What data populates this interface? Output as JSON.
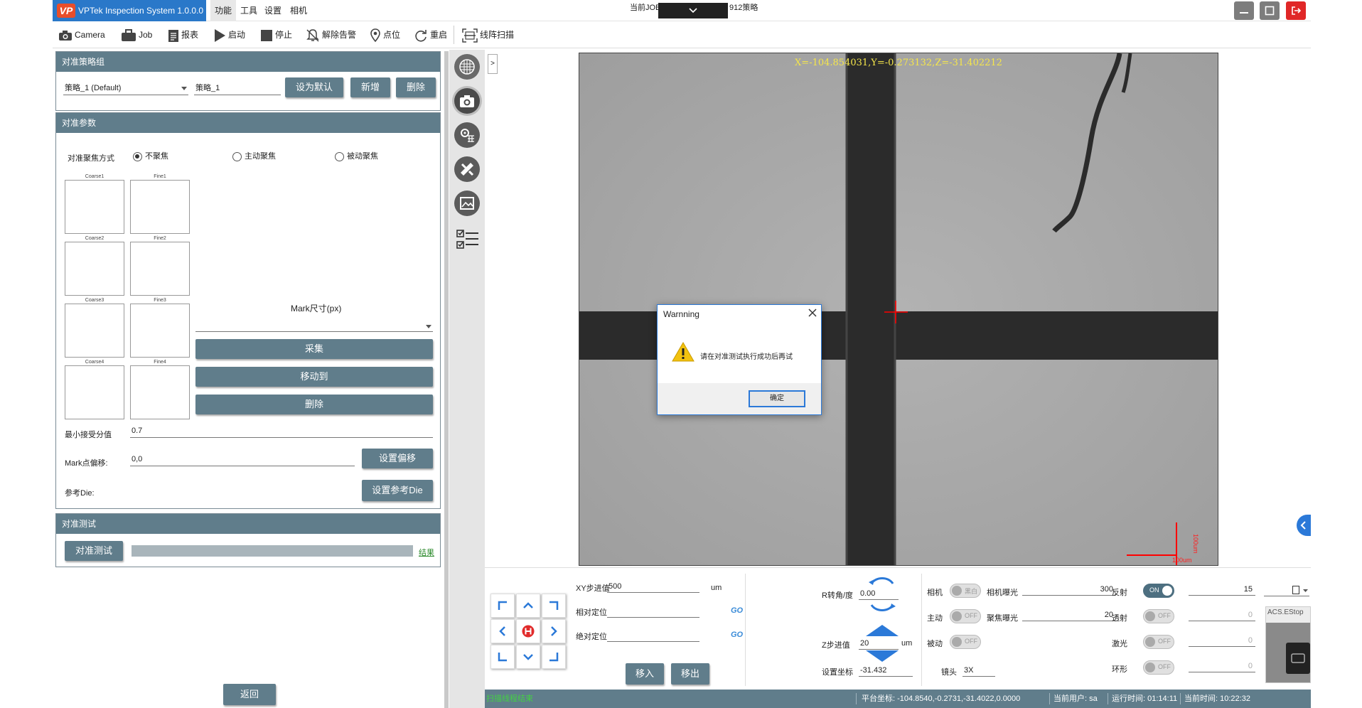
{
  "app": {
    "title": "VPTek Inspection System 1.0.0.0",
    "logo": "VP"
  },
  "menu": [
    "功能",
    "工具",
    "设置",
    "相机"
  ],
  "job": {
    "label_left": "当前JOB",
    "label_right": "912策略"
  },
  "toolbar": [
    "Camera",
    "Job",
    "报表",
    "启动",
    "停止",
    "解除告警",
    "点位",
    "重启",
    "线阵扫描"
  ],
  "strategy": {
    "header": "对准策略组",
    "select_value": "策略_1 (Default)",
    "name_value": "策略_1",
    "set_default": "设为默认",
    "add": "新增",
    "delete": "删除"
  },
  "params": {
    "header": "对准参数",
    "focus_label": "对准聚焦方式",
    "focus_options": [
      "不聚焦",
      "主动聚焦",
      "被动聚焦"
    ],
    "focus_selected": 0,
    "tiles": [
      "Coarse1",
      "Fine1",
      "Coarse2",
      "Fine2",
      "Coarse3",
      "Fine3",
      "Coarse4",
      "Fine4"
    ],
    "mark_size_label": "Mark尺寸(px)",
    "collect": "采集",
    "move_to": "移动到",
    "remove": "删除",
    "min_score_label": "最小接受分值",
    "min_score_value": "0.7",
    "mark_offset_label": "Mark点偏移:",
    "mark_offset_value": "0,0",
    "set_offset": "设置偏移",
    "ref_die_label": "参考Die:",
    "set_ref_die": "设置参考Die"
  },
  "test": {
    "header": "对准测试",
    "button": "对准测试",
    "result": "结果"
  },
  "back": "返回",
  "image": {
    "coords": "X=-104.854031,Y=-0.273132,Z=-31.402212",
    "scale": "100um"
  },
  "dialog": {
    "title": "Warnning",
    "message": "请在对准测试执行成功后再试",
    "ok": "确定"
  },
  "motion": {
    "xy_step_label": "XY步进值",
    "xy_step_value": "500",
    "xy_unit": "um",
    "rel_label": "相对定位",
    "abs_label": "绝对定位",
    "go": "GO",
    "move_in": "移入",
    "move_out": "移出",
    "r_label": "R转角/度",
    "r_value": "0.00",
    "z_step_label": "Z步进值",
    "z_step_value": "20",
    "z_unit": "um",
    "set_coord_label": "设置坐标",
    "set_coord_value": "-31.432"
  },
  "camera": {
    "rows": [
      {
        "label": "相机",
        "toggle": "黑白",
        "on": false,
        "param": "相机曝光",
        "value": "300"
      },
      {
        "label": "主动",
        "toggle": "OFF",
        "on": false,
        "param": "聚焦曝光",
        "value": "20"
      },
      {
        "label": "被动",
        "toggle": "OFF",
        "on": false
      }
    ],
    "lens_label": "镜头",
    "lens_value": "3X"
  },
  "lights": [
    {
      "label": "反射",
      "toggle": "ON",
      "on": true,
      "value": "15"
    },
    {
      "label": "透射",
      "toggle": "OFF",
      "on": false,
      "value": "0"
    },
    {
      "label": "激光",
      "toggle": "OFF",
      "on": false,
      "value": "0"
    },
    {
      "label": "环形",
      "toggle": "OFF",
      "on": false,
      "value": "0"
    }
  ],
  "estop": "ACS.EStop",
  "status": {
    "left": "扫描线程结束",
    "stage": "平台坐标: -104.8540,-0.2731,-31.4022,0.0000",
    "user": "当前用户: sa",
    "runtime": "运行时间: 01:14:11",
    "clock": "当前时间: 10:22:32"
  },
  "colors": {
    "panel_header": "#607d8b",
    "brand": "#2a78c9",
    "accent_link": "#2e8b2e",
    "crosshair": "#ff0000",
    "coords": "#f5e64a"
  }
}
